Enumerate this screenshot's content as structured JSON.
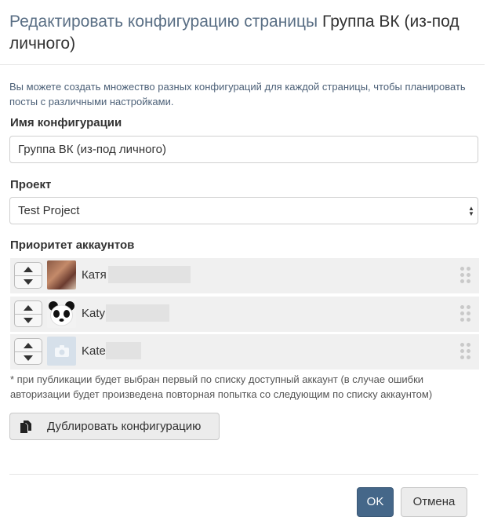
{
  "dialog": {
    "title_prefix": "Редактировать конфигурацию страницы",
    "title_name": "Группа ВК (из-под личного)",
    "intro": "Вы можете создать множество разных конфигураций для каждой страницы, чтобы планировать посты с различными настройками."
  },
  "config_name": {
    "label": "Имя конфигурации",
    "value": "Группа ВК (из-под личного)"
  },
  "project": {
    "label": "Проект",
    "selected": "Test Project"
  },
  "accounts": {
    "label": "Приоритет аккаунтов",
    "items": [
      {
        "name": "Катя",
        "avatar": "photo"
      },
      {
        "name": "Katy",
        "avatar": "panda"
      },
      {
        "name": "Kate",
        "avatar": "camera-placeholder-icon"
      }
    ],
    "note": "* при публикации будет выбран первый по списку доступный аккаунт (в случае ошибки авторизации будет произведена повторная попытка со следующим по списку аккаунтом)"
  },
  "buttons": {
    "duplicate": "Дублировать конфигурацию",
    "ok": "OK",
    "cancel": "Отмена"
  },
  "colors": {
    "primary": "#456789",
    "title": "#5a6f85"
  }
}
